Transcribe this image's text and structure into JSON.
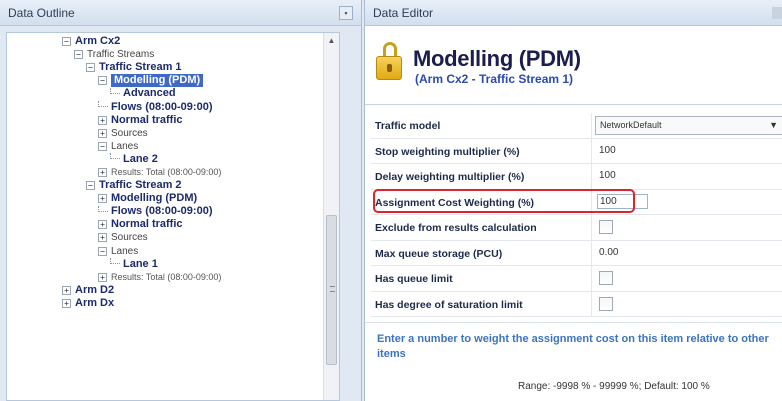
{
  "outline": {
    "header": "Data Outline",
    "tree": [
      {
        "label": "Arm Cx2",
        "indent": 0,
        "exp": "−",
        "style": "bold"
      },
      {
        "label": "Traffic Streams",
        "indent": 1,
        "exp": "−",
        "style": "plain"
      },
      {
        "label": "Traffic Stream 1",
        "indent": 2,
        "exp": "−",
        "style": "bold"
      },
      {
        "label": "Modelling (PDM)",
        "indent": 3,
        "exp": "−",
        "style": "sel"
      },
      {
        "label": "Advanced",
        "indent": 4,
        "exp": "",
        "style": "bold"
      },
      {
        "label": "Flows (08:00-09:00)",
        "indent": 3,
        "exp": "",
        "style": "bold"
      },
      {
        "label": "Normal traffic",
        "indent": 3,
        "exp": "+",
        "style": "bold"
      },
      {
        "label": "Sources",
        "indent": 3,
        "exp": "+",
        "style": "plain"
      },
      {
        "label": "Lanes",
        "indent": 3,
        "exp": "−",
        "style": "plain"
      },
      {
        "label": "Lane 2",
        "indent": 4,
        "exp": "",
        "style": "bold"
      },
      {
        "label": "Results: Total (08:00-09:00)",
        "indent": 3,
        "exp": "+",
        "style": "small"
      },
      {
        "label": "Traffic Stream 2",
        "indent": 2,
        "exp": "−",
        "style": "bold"
      },
      {
        "label": "Modelling (PDM)",
        "indent": 3,
        "exp": "+",
        "style": "bold"
      },
      {
        "label": "Flows (08:00-09:00)",
        "indent": 3,
        "exp": "",
        "style": "bold"
      },
      {
        "label": "Normal traffic",
        "indent": 3,
        "exp": "+",
        "style": "bold"
      },
      {
        "label": "Sources",
        "indent": 3,
        "exp": "+",
        "style": "plain"
      },
      {
        "label": "Lanes",
        "indent": 3,
        "exp": "−",
        "style": "plain"
      },
      {
        "label": "Lane 1",
        "indent": 4,
        "exp": "",
        "style": "bold"
      },
      {
        "label": "Results: Total (08:00-09:00)",
        "indent": 3,
        "exp": "+",
        "style": "small"
      },
      {
        "label": "Arm D2",
        "indent": 0,
        "exp": "+",
        "style": "bold"
      },
      {
        "label": "Arm Dx",
        "indent": 0,
        "exp": "+",
        "style": "bold"
      }
    ],
    "scroll_up": "▲",
    "scroll_down": "▼"
  },
  "editor": {
    "header": "Data Editor",
    "title": "Modelling (PDM)",
    "subtitle": "(Arm Cx2 - Traffic Stream 1)",
    "properties": [
      {
        "key": "Traffic model",
        "type": "dropdown",
        "value": "NetworkDefault"
      },
      {
        "key": "Stop weighting multiplier (%)",
        "type": "text",
        "value": "100"
      },
      {
        "key": "Delay weighting multiplier (%)",
        "type": "text",
        "value": "100"
      },
      {
        "key": "Assignment Cost Weighting (%)",
        "type": "text",
        "value": "100",
        "active": true
      },
      {
        "key": "Exclude from results calculation",
        "type": "checkbox",
        "value": ""
      },
      {
        "key": "Max queue storage (PCU)",
        "type": "text",
        "value": "0.00"
      },
      {
        "key": "Has queue limit",
        "type": "checkbox",
        "value": ""
      },
      {
        "key": "Has degree of saturation limit",
        "type": "checkbox",
        "value": ""
      }
    ],
    "help_text": "Enter a number to weight the assignment cost on this item relative to other items",
    "range_text": "Range: -9998 % - 99999 %; Default: 100 %"
  },
  "colors": {
    "highlight": "#d9252e",
    "selection": "#3e69c9",
    "help_text": "#3b74c2"
  }
}
